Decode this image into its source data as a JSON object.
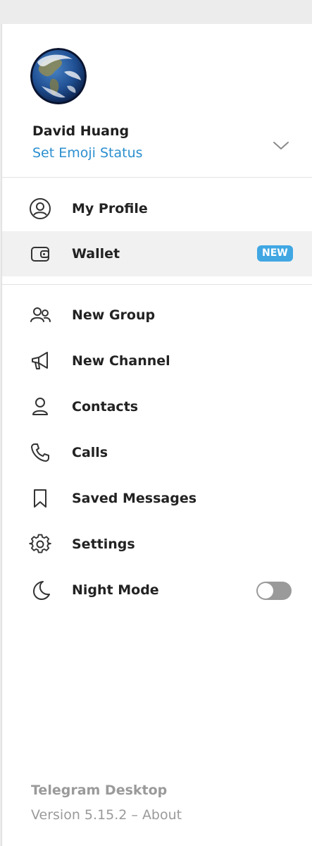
{
  "profile": {
    "name": "David Huang",
    "emoji_status": "Set Emoji Status"
  },
  "menu": {
    "my_profile": "My Profile",
    "wallet": "Wallet",
    "wallet_badge": "NEW",
    "new_group": "New Group",
    "new_channel": "New Channel",
    "contacts": "Contacts",
    "calls": "Calls",
    "saved_messages": "Saved Messages",
    "settings": "Settings",
    "night_mode": "Night Mode"
  },
  "night_mode_enabled": false,
  "footer": {
    "app_name": "Telegram Desktop",
    "version": "Version 5.15.2",
    "separator": " – ",
    "about": "About"
  },
  "colors": {
    "accent": "#2b8fcf",
    "badge": "#40a7e3",
    "active_row": "#f1f1f1",
    "muted_text": "#9a9a9a"
  },
  "icons": [
    "profile-circle-icon",
    "wallet-icon",
    "group-icon",
    "megaphone-icon",
    "person-icon",
    "phone-icon",
    "bookmark-icon",
    "gear-icon",
    "moon-icon",
    "chevron-down-icon"
  ]
}
